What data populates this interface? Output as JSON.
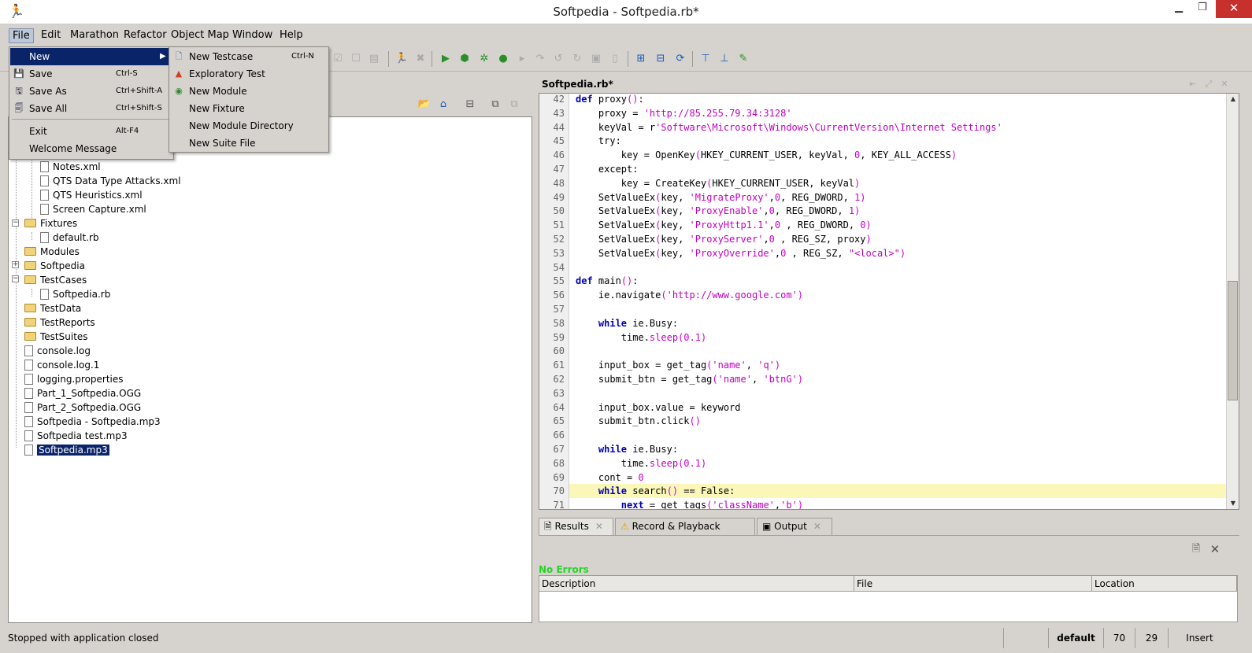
{
  "window": {
    "title": "Softpedia - Softpedia.rb*",
    "minimize_icon": "minimize-icon",
    "maximize_icon": "maximize-icon",
    "close_icon": "close-icon"
  },
  "menubar": {
    "items": [
      "File",
      "Edit",
      "Marathon",
      "Refactor",
      "Object Map",
      "Window",
      "Help"
    ]
  },
  "file_menu": {
    "items": [
      {
        "label": "New",
        "shortcut": "",
        "icon": ""
      },
      {
        "label": "Save",
        "shortcut": "Ctrl-S",
        "icon": "save-icon"
      },
      {
        "label": "Save As",
        "shortcut": "Ctrl+Shift-A",
        "icon": "save-as-icon"
      },
      {
        "label": "Save All",
        "shortcut": "Ctrl+Shift-S",
        "icon": "save-all-icon"
      },
      {
        "label": "Exit",
        "shortcut": "Alt-F4",
        "icon": ""
      },
      {
        "label": "Welcome Message",
        "shortcut": "",
        "icon": ""
      }
    ]
  },
  "new_submenu": {
    "items": [
      {
        "label": "New Testcase",
        "shortcut": "Ctrl-N",
        "icon": "new-testcase-icon"
      },
      {
        "label": "Exploratory Test",
        "shortcut": "",
        "icon": "exploratory-test-icon"
      },
      {
        "label": "New Module",
        "shortcut": "",
        "icon": "new-module-icon"
      },
      {
        "label": "New Fixture",
        "shortcut": "",
        "icon": ""
      },
      {
        "label": "New Module Directory",
        "shortcut": "",
        "icon": ""
      },
      {
        "label": "New Suite File",
        "shortcut": "",
        "icon": ""
      }
    ]
  },
  "tree": {
    "partial_label": "xml",
    "nodes": [
      {
        "label": "Notes.xml",
        "type": "file"
      },
      {
        "label": "QTS Data Type Attacks.xml",
        "type": "file"
      },
      {
        "label": "QTS Heuristics.xml",
        "type": "file"
      },
      {
        "label": "Screen Capture.xml",
        "type": "file"
      },
      {
        "label": "Fixtures",
        "type": "folder"
      },
      {
        "label": "default.rb",
        "type": "file"
      },
      {
        "label": "Modules",
        "type": "folder"
      },
      {
        "label": "Softpedia",
        "type": "folder"
      },
      {
        "label": "TestCases",
        "type": "folder"
      },
      {
        "label": "Softpedia.rb",
        "type": "file"
      },
      {
        "label": "TestData",
        "type": "folder"
      },
      {
        "label": "TestReports",
        "type": "folder"
      },
      {
        "label": "TestSuites",
        "type": "folder"
      },
      {
        "label": "console.log",
        "type": "file"
      },
      {
        "label": "console.log.1",
        "type": "file"
      },
      {
        "label": "logging.properties",
        "type": "file"
      },
      {
        "label": "Part_1_Softpedia.OGG",
        "type": "file"
      },
      {
        "label": "Part_2_Softpedia.OGG",
        "type": "file"
      },
      {
        "label": "Softpedia - Softpedia.mp3",
        "type": "file"
      },
      {
        "label": "Softpedia test.mp3",
        "type": "file"
      },
      {
        "label": "Softpedia.mp3",
        "type": "file"
      }
    ]
  },
  "editor": {
    "tab_title": "Softpedia.rb*",
    "current_line": "70",
    "lines": [
      {
        "n": "42",
        "text": "def proxy():"
      },
      {
        "n": "43",
        "text": "    proxy = 'http://85.255.79.34:3128'"
      },
      {
        "n": "44",
        "text": "    keyVal = r'Software\\Microsoft\\Windows\\CurrentVersion\\Internet Settings'"
      },
      {
        "n": "45",
        "text": "    try:"
      },
      {
        "n": "46",
        "text": "        key = OpenKey(HKEY_CURRENT_USER, keyVal, 0, KEY_ALL_ACCESS)"
      },
      {
        "n": "47",
        "text": "    except:"
      },
      {
        "n": "48",
        "text": "        key = CreateKey(HKEY_CURRENT_USER, keyVal)"
      },
      {
        "n": "49",
        "text": "    SetValueEx(key, 'MigrateProxy',0, REG_DWORD, 1)"
      },
      {
        "n": "50",
        "text": "    SetValueEx(key, 'ProxyEnable',0, REG_DWORD, 1)"
      },
      {
        "n": "51",
        "text": "    SetValueEx(key, 'ProxyHttp1.1',0 , REG_DWORD, 0)"
      },
      {
        "n": "52",
        "text": "    SetValueEx(key, 'ProxyServer',0 , REG_SZ, proxy)"
      },
      {
        "n": "53",
        "text": "    SetValueEx(key, 'ProxyOverride',0 , REG_SZ, \"<local>\")"
      },
      {
        "n": "54",
        "text": ""
      },
      {
        "n": "55",
        "text": "def main():"
      },
      {
        "n": "56",
        "text": "    ie.navigate('http://www.google.com')"
      },
      {
        "n": "57",
        "text": ""
      },
      {
        "n": "58",
        "text": "    while ie.Busy:"
      },
      {
        "n": "59",
        "text": "        time.sleep(0.1)"
      },
      {
        "n": "60",
        "text": ""
      },
      {
        "n": "61",
        "text": "    input_box = get_tag('name', 'q')"
      },
      {
        "n": "62",
        "text": "    submit_btn = get_tag('name', 'btnG')"
      },
      {
        "n": "63",
        "text": ""
      },
      {
        "n": "64",
        "text": "    input_box.value = keyword"
      },
      {
        "n": "65",
        "text": "    submit_btn.click()"
      },
      {
        "n": "66",
        "text": ""
      },
      {
        "n": "67",
        "text": "    while ie.Busy:"
      },
      {
        "n": "68",
        "text": "        time.sleep(0.1)"
      },
      {
        "n": "69",
        "text": "    cont = 0"
      },
      {
        "n": "70",
        "text": "    while search() == False:"
      },
      {
        "n": "71",
        "text": "        next = get_tags('className','b')"
      }
    ]
  },
  "results": {
    "tabs": [
      "Results",
      "Record & Playback Log",
      "Output"
    ],
    "status": "No Errors",
    "columns": [
      "Description",
      "File",
      "Location"
    ]
  },
  "statusbar": {
    "message": "Stopped with application closed",
    "profile": "default",
    "line": "70",
    "column": "29",
    "mode": "Insert"
  }
}
